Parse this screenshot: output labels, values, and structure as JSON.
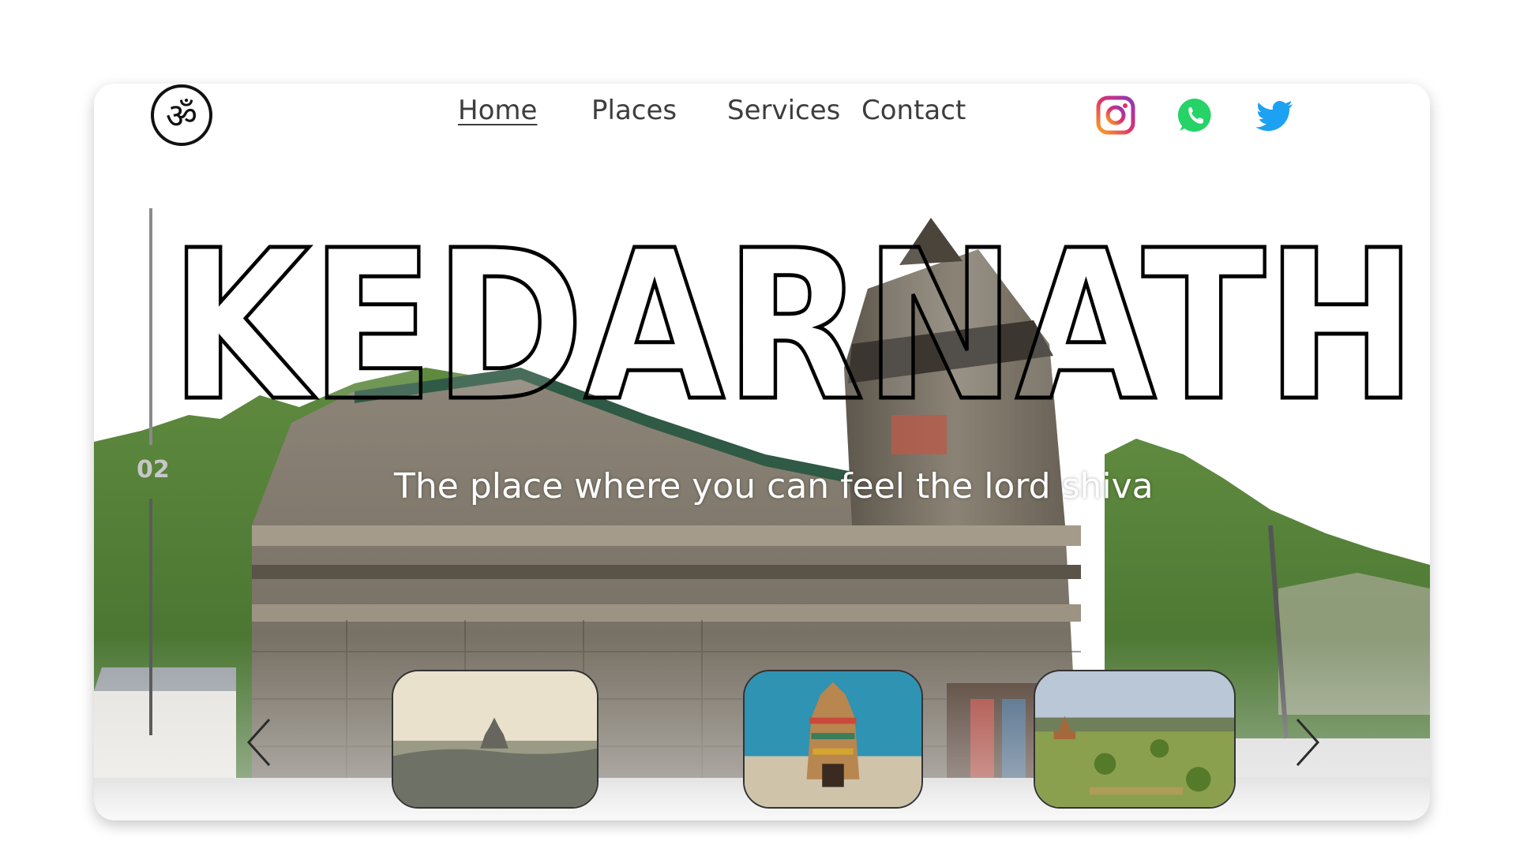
{
  "header": {
    "logo_icon": "om-symbol-icon",
    "nav": [
      {
        "label": "Home",
        "active": true
      },
      {
        "label": "Places",
        "active": false
      },
      {
        "label": "Services",
        "active": false
      },
      {
        "label": "Contact",
        "active": false
      }
    ],
    "social": [
      {
        "name": "instagram-icon"
      },
      {
        "name": "whatsapp-icon"
      },
      {
        "name": "twitter-icon"
      }
    ]
  },
  "hero": {
    "title": "KEDARNATH",
    "subtitle": "The place where you can feel the lord shiva",
    "slide_number": "02"
  },
  "carousel": {
    "prev_icon": "chevron-left-icon",
    "next_icon": "chevron-right-icon",
    "items": [
      {
        "name": "misty-temple-plain"
      },
      {
        "name": "gopuram-temple"
      },
      {
        "name": "bagan-temples-landscape"
      }
    ]
  },
  "colors": {
    "instagram_gradient": [
      "#f9a31e",
      "#e1306c",
      "#8a3ab9"
    ],
    "whatsapp": "#25d366",
    "twitter": "#1da1f2",
    "nav_text": "#3d3d3d"
  }
}
